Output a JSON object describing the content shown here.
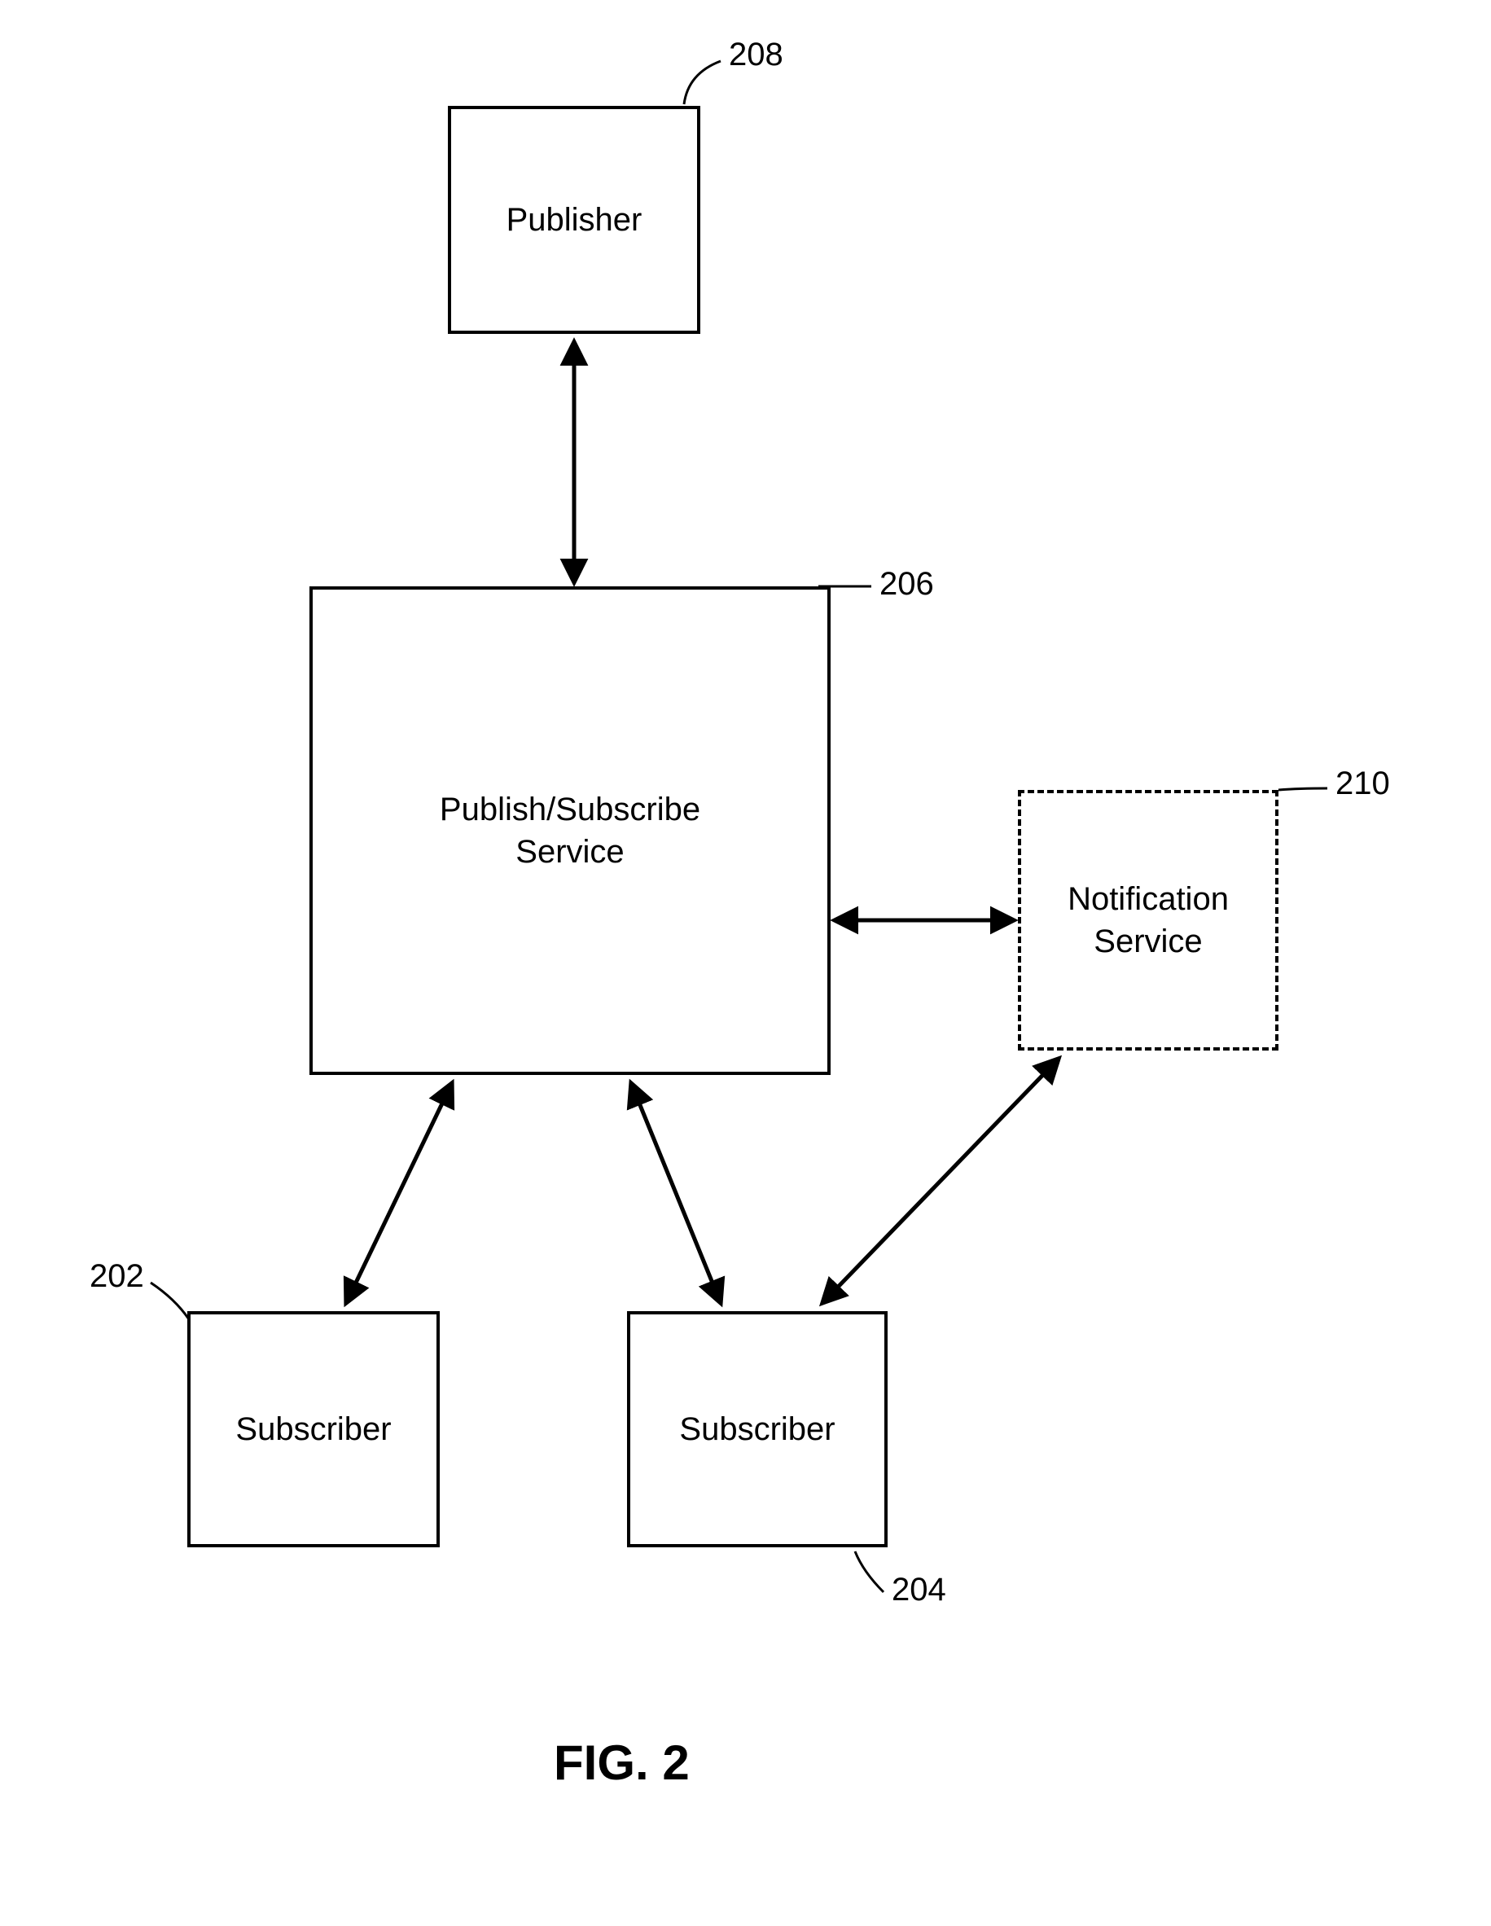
{
  "diagram": {
    "caption": "FIG. 2",
    "nodes": {
      "publisher": {
        "label": "Publisher",
        "ref": "208"
      },
      "service": {
        "label": "Publish/Subscribe\nService",
        "ref": "206"
      },
      "notification": {
        "label": "Notification\nService",
        "ref": "210"
      },
      "subscriber1": {
        "label": "Subscriber",
        "ref": "202"
      },
      "subscriber2": {
        "label": "Subscriber",
        "ref": "204"
      }
    }
  }
}
